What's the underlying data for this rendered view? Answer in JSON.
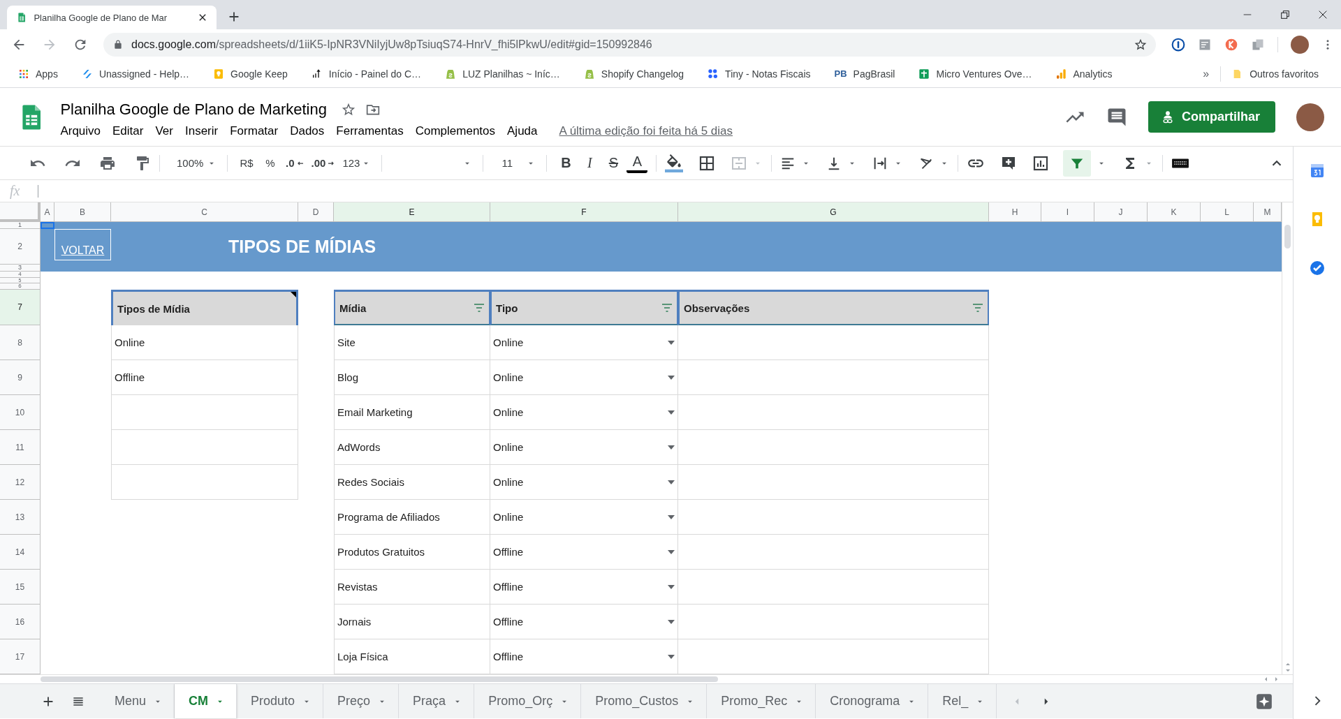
{
  "browser": {
    "tab": {
      "title": "Planilha Google de Plano de Mar"
    },
    "address": {
      "host": "docs.google.com",
      "path": "/spreadsheets/d/1iiK5-IpNR3VNiIyjUw8pTsiuqS74-HnrV_fhi5lPkwU/edit#gid=150992846"
    },
    "bookmarks": [
      {
        "kind": "apps",
        "label": "Apps"
      },
      {
        "kind": "slashes",
        "label": "Unassigned - Help…"
      },
      {
        "kind": "bulb",
        "label": "Google Keep"
      },
      {
        "kind": "arrows",
        "label": "Início - Painel do C…"
      },
      {
        "kind": "bag",
        "label": "LUZ Planilhas ~ Iníc…"
      },
      {
        "kind": "bag",
        "label": "Shopify Changelog"
      },
      {
        "kind": "dots",
        "label": "Tiny - Notas Fiscais"
      },
      {
        "kind": "monogram",
        "monogram": "PB",
        "label": "PagBrasil"
      },
      {
        "kind": "sheet",
        "label": "Micro Ventures Ove…"
      },
      {
        "kind": "bars",
        "label": "Analytics"
      }
    ],
    "bookmarks_overflow": "»",
    "other_bookmarks": {
      "label": "Outros favoritos"
    }
  },
  "document": {
    "title": "Planilha Google de Plano de Marketing",
    "menu": [
      "Arquivo",
      "Editar",
      "Ver",
      "Inserir",
      "Formatar",
      "Dados",
      "Ferramentas",
      "Complementos",
      "Ajuda"
    ],
    "last_edit": "A última edição foi feita há 5 dias",
    "share_label": "Compartilhar"
  },
  "toolbar": {
    "zoom": "100%",
    "currency": "R$",
    "percent": "%",
    "decrease_decimals": ".0",
    "increase_decimals": ".00",
    "number_format": "123",
    "font_size": "11",
    "text_styles": [
      {
        "kind": "bold",
        "glyph": "B"
      },
      {
        "kind": "italic",
        "glyph": "I"
      },
      {
        "kind": "strikethrough",
        "glyph": "S"
      },
      {
        "kind": "color",
        "glyph": "A"
      }
    ],
    "filter_active": true
  },
  "formula_bar": {
    "label": "fx"
  },
  "grid": {
    "columns": [
      {
        "label": "A",
        "selected": false
      },
      {
        "label": "B",
        "selected": false
      },
      {
        "label": "C",
        "selected": false
      },
      {
        "label": "D",
        "selected": false
      },
      {
        "label": "E",
        "selected": true
      },
      {
        "label": "F",
        "selected": true
      },
      {
        "label": "G",
        "selected": true
      },
      {
        "label": "H",
        "selected": false
      },
      {
        "label": "I",
        "selected": false
      },
      {
        "label": "J",
        "selected": false
      },
      {
        "label": "K",
        "selected": false
      },
      {
        "label": "L",
        "selected": false
      },
      {
        "label": "M",
        "selected": false
      }
    ],
    "rows": [
      {
        "label": "1",
        "selected": false
      },
      {
        "label": "2",
        "selected": false
      },
      {
        "label": "3",
        "selected": false
      },
      {
        "label": "4",
        "selected": false
      },
      {
        "label": "5",
        "selected": false
      },
      {
        "label": "6",
        "selected": false
      },
      {
        "label": "7",
        "selected": true
      },
      {
        "label": "8",
        "selected": false
      },
      {
        "label": "9",
        "selected": false
      },
      {
        "label": "10",
        "selected": false
      },
      {
        "label": "11",
        "selected": false
      },
      {
        "label": "12",
        "selected": false
      },
      {
        "label": "13",
        "selected": false
      },
      {
        "label": "14",
        "selected": false
      },
      {
        "label": "15",
        "selected": false
      },
      {
        "label": "16",
        "selected": false
      },
      {
        "label": "17",
        "selected": false
      }
    ]
  },
  "banner": {
    "link": "VOLTAR",
    "title": "TIPOS DE MÍDIAS"
  },
  "media_types_table": {
    "header": "Tipos de Mídia",
    "rows": [
      "Online",
      "Offline"
    ]
  },
  "media_table": {
    "columns": [
      {
        "label": "Mídia",
        "filter": true
      },
      {
        "label": "Tipo",
        "filter": true
      },
      {
        "label": "Observações",
        "filter": true
      }
    ],
    "rows": [
      {
        "media": "Site",
        "type": "Online"
      },
      {
        "media": "Blog",
        "type": "Online"
      },
      {
        "media": "Email Marketing",
        "type": "Online"
      },
      {
        "media": "AdWords",
        "type": "Online"
      },
      {
        "media": "Redes Sociais",
        "type": "Online"
      },
      {
        "media": "Programa de Afiliados",
        "type": "Online"
      },
      {
        "media": "Produtos Gratuitos",
        "type": "Offline"
      },
      {
        "media": "Revistas",
        "type": "Offline"
      },
      {
        "media": "Jornais",
        "type": "Offline"
      },
      {
        "media": "Loja Física",
        "type": "Offline"
      }
    ]
  },
  "sheet_tabs": [
    {
      "label": "Menu",
      "selected": false
    },
    {
      "label": "CM",
      "selected": true
    },
    {
      "label": "Produto",
      "selected": false
    },
    {
      "label": "Preço",
      "selected": false
    },
    {
      "label": "Praça",
      "selected": false
    },
    {
      "label": "Promo_Orç",
      "selected": false
    },
    {
      "label": "Promo_Custos",
      "selected": false
    },
    {
      "label": "Promo_Rec",
      "selected": false
    },
    {
      "label": "Cronograma",
      "selected": false
    },
    {
      "label": "Rel_",
      "selected": false
    }
  ]
}
